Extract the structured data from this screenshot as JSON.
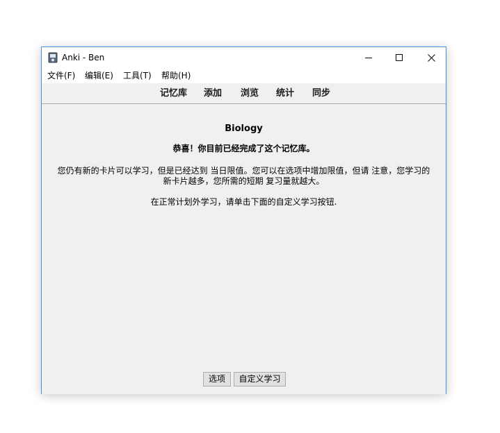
{
  "window": {
    "title": "Anki - Ben",
    "controls": {
      "minimize_icon": "minimize-icon",
      "maximize_icon": "maximize-icon",
      "close_icon": "close-icon"
    }
  },
  "menubar": {
    "items": [
      {
        "label": "文件(F)"
      },
      {
        "label": "编辑(E)"
      },
      {
        "label": "工具(T)"
      },
      {
        "label": "帮助(H)"
      }
    ]
  },
  "toolbar": {
    "links": [
      {
        "label": "记忆库"
      },
      {
        "label": "添加"
      },
      {
        "label": "浏览"
      },
      {
        "label": "统计"
      },
      {
        "label": "同步"
      }
    ]
  },
  "overview": {
    "deck_name": "Biology",
    "congrats": "恭喜！你目前已经完成了这个记忆库。",
    "limit_note": "您仍有新的卡片可以学习，但是已经达到 当日限值。您可以在选项中增加限值，但请 注意，您学习的新卡片越多，您所需的短期 复习量就越大。",
    "custom_note": "在正常计划外学习，请单击下面的自定义学习按钮."
  },
  "buttons": {
    "options": "选项",
    "custom_study": "自定义学习"
  },
  "colors": {
    "window_border": "#4a90d9",
    "background": "#f0f0f0"
  }
}
